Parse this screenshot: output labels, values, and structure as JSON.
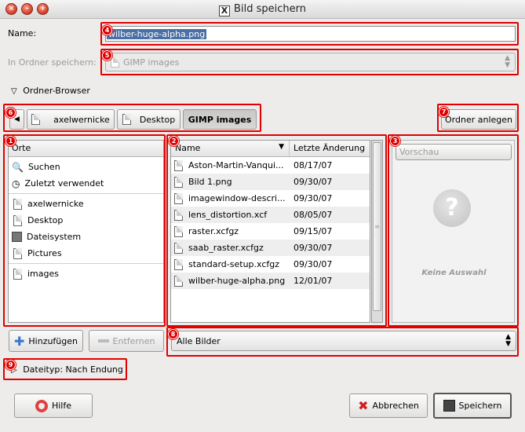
{
  "window": {
    "title": "Bild speichern",
    "x_glyph": "X"
  },
  "name_field": {
    "label": "Name:",
    "value": "wilber-huge-alpha.png"
  },
  "save_in": {
    "label": "In Ordner speichern:",
    "value": "GIMP images"
  },
  "browser_toggle": {
    "label": "Ordner-Browser"
  },
  "path_bar": {
    "segments": [
      "axelwernicke",
      "Desktop",
      "GIMP images"
    ]
  },
  "create_folder": {
    "label": "Ordner anlegen"
  },
  "places": {
    "header": "Orte",
    "items": [
      {
        "label": "Suchen",
        "icon": "search-icon"
      },
      {
        "label": "Zuletzt verwendet",
        "icon": "recent-icon"
      },
      {
        "label": "axelwernicke",
        "icon": "document-icon"
      },
      {
        "label": "Desktop",
        "icon": "document-icon"
      },
      {
        "label": "Dateisystem",
        "icon": "harddisk-icon"
      },
      {
        "label": "Pictures",
        "icon": "document-icon"
      },
      {
        "label": "images",
        "icon": "document-icon"
      }
    ]
  },
  "files": {
    "col_name": "Name",
    "col_modified": "Letzte Änderung",
    "rows": [
      {
        "name": "Aston-Martin-Vanqui...",
        "date": "08/17/07"
      },
      {
        "name": "Bild 1.png",
        "date": "09/30/07"
      },
      {
        "name": "imagewindow-descri...",
        "date": "09/30/07"
      },
      {
        "name": "lens_distortion.xcf",
        "date": "08/05/07"
      },
      {
        "name": "raster.xcfgz",
        "date": "09/15/07"
      },
      {
        "name": "saab_raster.xcfgz",
        "date": "09/30/07"
      },
      {
        "name": "standard-setup.xcfgz",
        "date": "09/30/07"
      },
      {
        "name": "wilber-huge-alpha.png",
        "date": "12/01/07"
      }
    ]
  },
  "preview": {
    "button": "Vorschau",
    "empty_text": "Keine Auswahl"
  },
  "add_button": {
    "label": "Hinzufügen"
  },
  "remove_button": {
    "label": "Entfernen"
  },
  "filter": {
    "value": "Alle Bilder"
  },
  "filetype": {
    "label": "Dateityp: Nach Endung"
  },
  "help_button": {
    "label": "Hilfe"
  },
  "cancel_button": {
    "label": "Abbrechen"
  },
  "save_button": {
    "label": "Speichern"
  },
  "badges": [
    "1",
    "2",
    "3",
    "4",
    "5",
    "6",
    "7",
    "8",
    "9"
  ],
  "colors": {
    "annotation": "#e00000",
    "dialog_bg": "#edeceb",
    "selection": "#4a6fa5"
  }
}
